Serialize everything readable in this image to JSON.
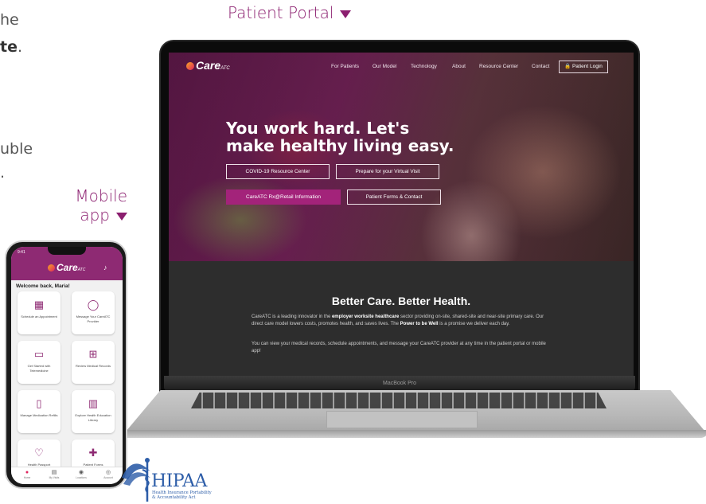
{
  "left_text": {
    "line1": "he",
    "line2": "te",
    "line2_suffix": ".",
    "line3": "uble",
    "line4": "."
  },
  "callouts": {
    "patient_portal": "Patient Portal",
    "mobile_app_1": "Mobile",
    "mobile_app_2": "app"
  },
  "website": {
    "logo": "Care",
    "logo_suffix": "ATC",
    "nav": [
      "For Patients",
      "Our Model",
      "Technology",
      "About",
      "Resource Center",
      "Contact"
    ],
    "login": "🔒 Patient Login",
    "headline_1": "You work hard. Let's",
    "headline_2": "make healthy living easy.",
    "buttons": {
      "covid": "COVID-19 Resource Center",
      "virtual": "Prepare for your Virtual Visit",
      "rx": "CareATC Rx@Retail Information",
      "forms": "Patient Forms & Contact"
    },
    "about_title": "Better Care. Better Health.",
    "about_p1_a": "CareATC is a leading innovator in the ",
    "about_p1_b": "employer worksite healthcare",
    "about_p1_c": " sector providing on-site, shared-site and near-site primary care. Our direct care model lowers costs, promotes health, and saves lives. The ",
    "about_p1_d": "Power to be Well",
    "about_p1_e": " is a promise we deliver each day.",
    "about_p2": "You can view your medical records, schedule appointments, and message your CareATC provider at any time in the patient portal or mobile app!"
  },
  "laptop": {
    "brand": "MacBook Pro"
  },
  "phone": {
    "status_time": "9:41",
    "logo": "Care",
    "logo_suffix": "ATC",
    "welcome": "Welcome back, Maria!",
    "tiles": [
      {
        "icon": "calendar-icon",
        "glyph": "▦",
        "label": "Schedule an Appointment"
      },
      {
        "icon": "chat-icon",
        "glyph": "◯",
        "label": "Message Your CareATC Provider"
      },
      {
        "icon": "telemedicine-icon",
        "glyph": "▭",
        "label": "Get Started with Telemedicine"
      },
      {
        "icon": "medical-records-icon",
        "glyph": "⊞",
        "label": "Review Medical Records"
      },
      {
        "icon": "pill-bottle-icon",
        "glyph": "▯",
        "label": "Manage Medication Refills"
      },
      {
        "icon": "library-icon",
        "glyph": "▥",
        "label": "Explore Health Education Library"
      },
      {
        "icon": "heart-icon",
        "glyph": "♡",
        "label": "Health Passport"
      },
      {
        "icon": "clipboard-icon",
        "glyph": "✚",
        "label": "Patient Forms"
      }
    ],
    "tabs": [
      {
        "icon": "home-icon",
        "glyph": "●",
        "label": "Home"
      },
      {
        "icon": "visits-icon",
        "glyph": "▤",
        "label": "My Visits"
      },
      {
        "icon": "location-icon",
        "glyph": "◉",
        "label": "Locations"
      },
      {
        "icon": "account-icon",
        "glyph": "◎",
        "label": "Account"
      }
    ]
  },
  "hipaa": {
    "word": "HIPAA",
    "sub1": "Health Insurance Portability",
    "sub2": "& Accountability Act"
  },
  "colors": {
    "brand_purple": "#8b1e6f",
    "hipaa_blue": "#2d5da8"
  }
}
